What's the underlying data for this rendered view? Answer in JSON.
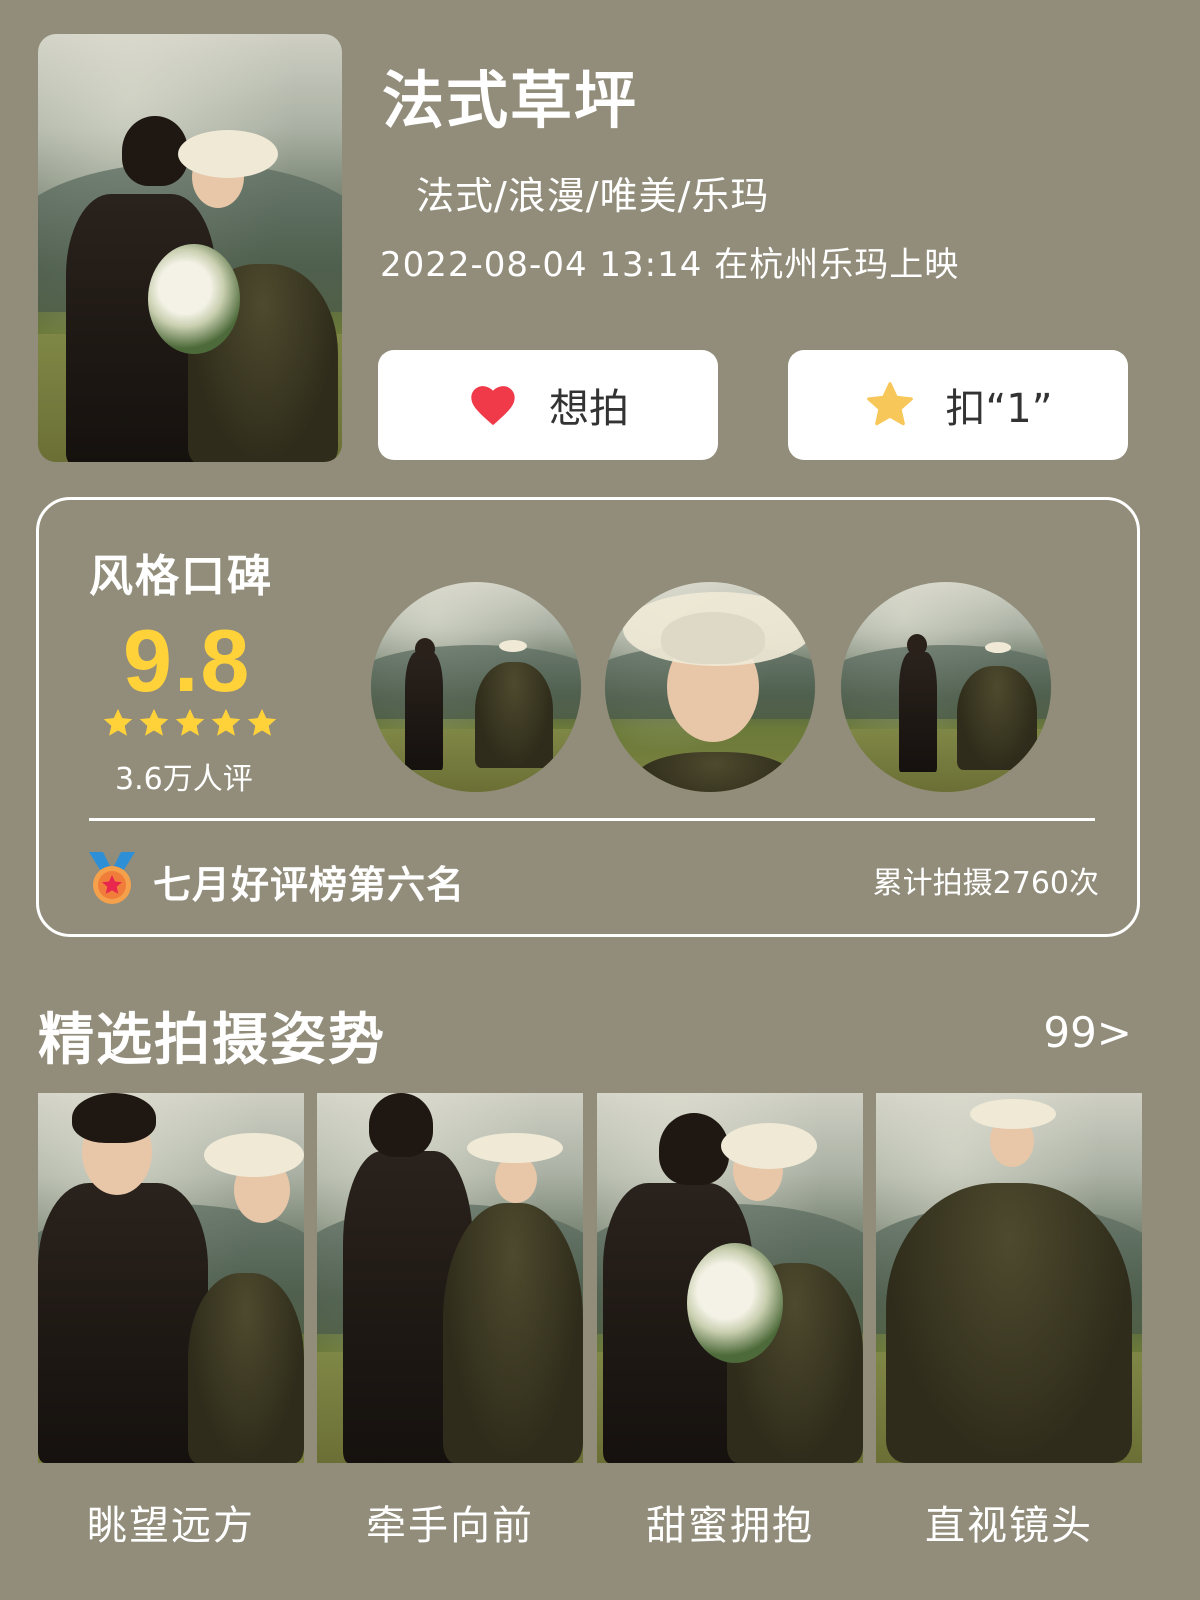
{
  "header": {
    "title": "法式草坪",
    "tags": "法式/浪漫/唯美/乐玛",
    "release": "2022-08-04 13:14 在杭州乐玛上映",
    "want_label": "想拍",
    "one_label": "扣“1”",
    "icons": {
      "want": "heart-icon",
      "one": "star-icon"
    },
    "colors": {
      "heart": "#f03a4a",
      "star": "#f7c75a"
    }
  },
  "rating": {
    "heading": "风格口碑",
    "score": "9.8",
    "stars": 5,
    "review_count": "3.6万人评",
    "rank": "七月好评榜第六名",
    "shoot_count": "累计拍摄2760次",
    "colors": {
      "score": "#ffd23a"
    }
  },
  "poses": {
    "title": "精选拍摄姿势",
    "more": "99>",
    "items": [
      {
        "label": "眺望远方"
      },
      {
        "label": "牵手向前"
      },
      {
        "label": "甜蜜拥抱"
      },
      {
        "label": "直视镜头"
      }
    ]
  },
  "theme": {
    "background": "#918d7a",
    "text": "#ffffff"
  }
}
